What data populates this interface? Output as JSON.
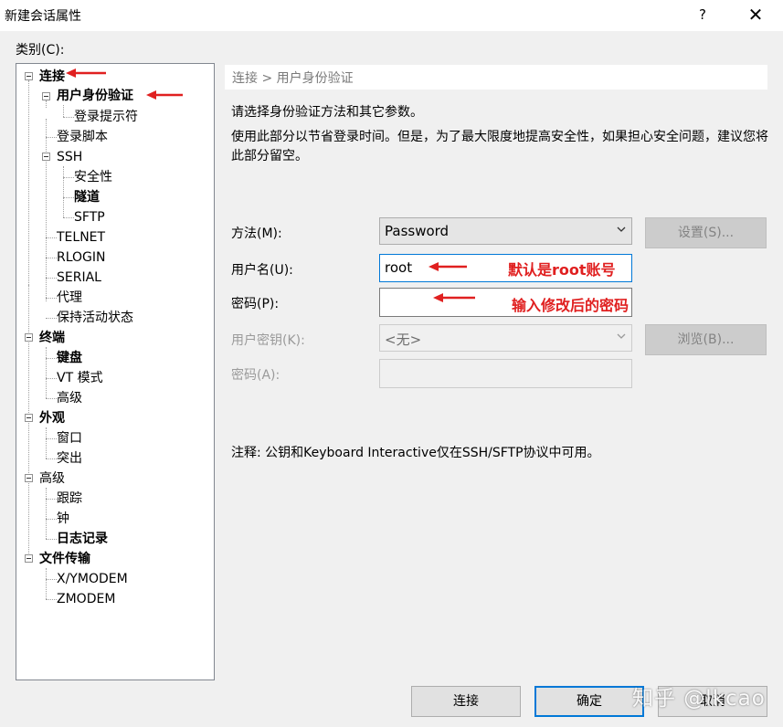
{
  "window": {
    "title": "新建会话属性",
    "help_label": "?",
    "close_label": "✕"
  },
  "category_label": "类别(C):",
  "tree": {
    "connection": "连接",
    "user_auth": "用户身份验证",
    "login_prompt": "登录提示符",
    "login_script": "登录脚本",
    "ssh": "SSH",
    "security": "安全性",
    "tunnel": "隧道",
    "sftp": "SFTP",
    "telnet": "TELNET",
    "rlogin": "RLOGIN",
    "serial": "SERIAL",
    "proxy": "代理",
    "keepalive": "保持活动状态",
    "terminal": "终端",
    "keyboard": "键盘",
    "vt_mode": "VT 模式",
    "advanced_term": "高级",
    "appearance": "外观",
    "window": "窗口",
    "highlight": "突出",
    "advanced": "高级",
    "trace": "跟踪",
    "bell": "钟",
    "logging": "日志记录",
    "file_transfer": "文件传输",
    "xymodem": "X/YMODEM",
    "zmodem": "ZMODEM"
  },
  "main": {
    "breadcrumb": "连接 > 用户身份验证",
    "desc1": "请选择身份验证方法和其它参数。",
    "desc2": "使用此部分以节省登录时间。但是，为了最大限度地提高安全性，如果担心安全问题，建议您将此部分留空。",
    "method_label": "方法(M):",
    "method_value": "Password",
    "settings_button": "设置(S)...",
    "username_label": "用户名(U):",
    "username_value": "root",
    "password_label": "密码(P):",
    "password_value": "",
    "userkey_label": "用户密钥(K):",
    "userkey_value": "<无>",
    "browse_button": "浏览(B)...",
    "passphrase_label": "密码(A):",
    "note": "注释: 公钥和Keyboard Interactive仅在SSH/SFTP协议中可用。"
  },
  "annotations": {
    "username_hint": "默认是root账号",
    "password_hint": "输入修改后的密码"
  },
  "footer": {
    "connect_button": "连接",
    "ok_button": "确定",
    "cancel_button": "取消"
  },
  "watermark": "知乎 @lkcao",
  "colors": {
    "annotation_red": "#e02020",
    "focus_blue": "#0078d7"
  }
}
